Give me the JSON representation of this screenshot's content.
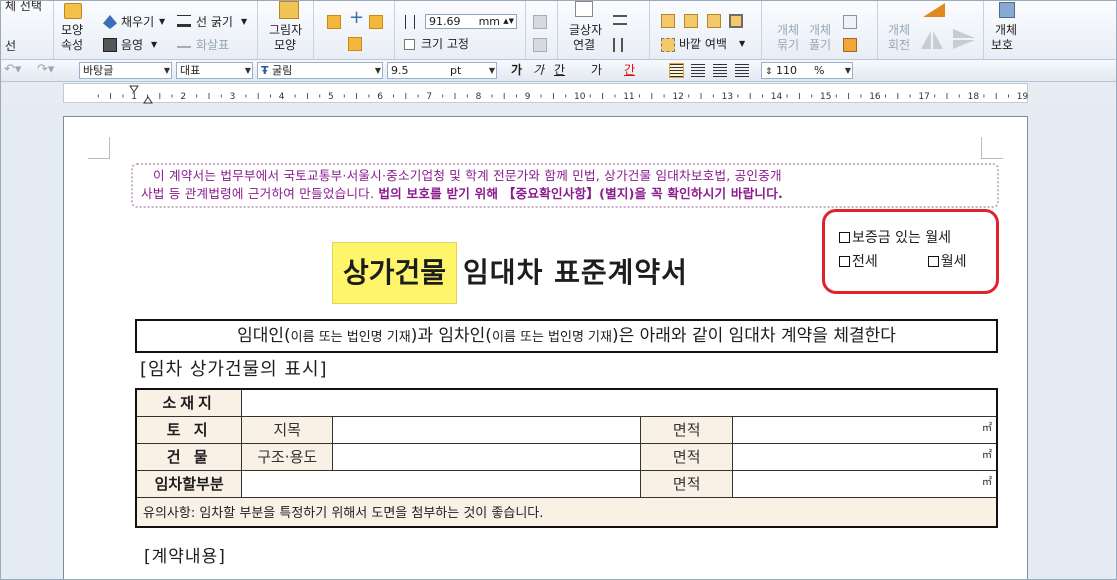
{
  "ribbon": {
    "select_label": "체 선택",
    "select_sub": "선",
    "shape_props": "모양",
    "shape_props2": "속성",
    "fill": "채우기",
    "shadow": "음영",
    "arrow": "화살표",
    "line_thickness": "선 굵기",
    "picture_shape": "그림자",
    "picture_shape2": "모양",
    "width_value": "91.69",
    "width_unit": "mm",
    "fix_size": "크기 고정",
    "textbox_link": "글상자",
    "textbox_link2": "연결",
    "outer_margin": "바깥 여백",
    "obj_group": "개체",
    "obj_group2": "묶기",
    "obj_ungroup": "개체",
    "obj_ungroup2": "풀기",
    "obj_rotate": "개체",
    "obj_rotate2": "회전",
    "obj_protect": "개체",
    "obj_protect2": "보호"
  },
  "format_bar": {
    "style": "바탕글",
    "lang": "대표",
    "font": "굴림",
    "size": "9.5",
    "size_unit": "pt",
    "bold": "가",
    "italic": "가",
    "underline": "간",
    "strike": "가",
    "color": "간",
    "zoom": "110",
    "zoom_unit": "%"
  },
  "ruler_numbers": [
    "1",
    "2",
    "3",
    "4",
    "5",
    "6",
    "7",
    "8",
    "9",
    "10",
    "11",
    "12",
    "13",
    "14",
    "15",
    "16",
    "17",
    "18",
    "19"
  ],
  "document": {
    "notice_line1": "이 계약서는 법무부에서 국토교통부·서울시·중소기업청 및 학계 전문가와 함께 민법, 상가건물 임대차보호법, 공인중개",
    "notice_line2_normal": "사법 등 관계법령에 근거하여 만들었습니다.",
    "notice_line2_bold": "법의 보호를 받기 위해 【중요확인사항】(별지)을 꼭 확인하시기 바랍니다.",
    "title_highlight": "상가건물",
    "title_rest": "임대차 표준계약서",
    "type_option1": "보증금 있는 월세",
    "type_option2": "전세",
    "type_option3": "월세",
    "intro_a": "임대인(",
    "intro_b": "이름 또는 법인명 기재",
    "intro_c": ")과 임차인(",
    "intro_d": "이름 또는 법인명 기재",
    "intro_e": ")은 아래와 같이 임대차 계약을 체결한다",
    "section1": "[임차 상가건물의 표시]",
    "rows": {
      "location": "소재지",
      "land": "토  지",
      "land_sub": "지목",
      "building": "건  물",
      "building_sub": "구조·용도",
      "leased_part": "임차할부분",
      "area": "면적",
      "unit": "㎡",
      "note": "유의사항: 임차할 부분을 특정하기 위해서 도면을 첨부하는 것이 좋습니다."
    },
    "section2": "[계약내용]"
  }
}
